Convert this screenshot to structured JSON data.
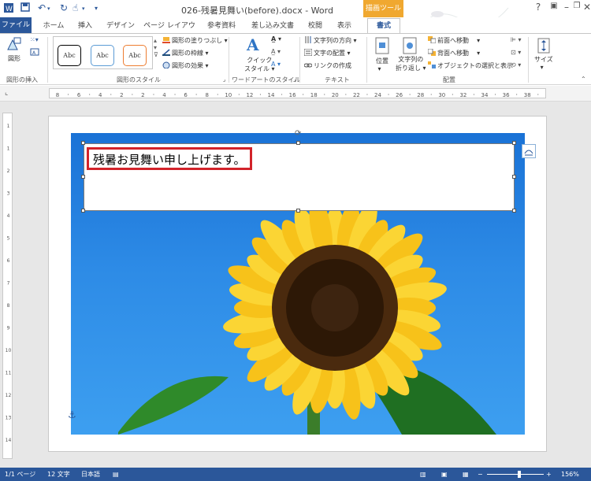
{
  "window": {
    "title": "026-残暑見舞い(before).docx - Word",
    "context_tab_group": "描画ツール"
  },
  "tabs": [
    {
      "label": "ファイル"
    },
    {
      "label": "ホーム"
    },
    {
      "label": "挿入"
    },
    {
      "label": "デザイン"
    },
    {
      "label": "ページ レイアウト"
    },
    {
      "label": "参考資料"
    },
    {
      "label": "差し込み文書"
    },
    {
      "label": "校閲"
    },
    {
      "label": "表示"
    },
    {
      "label": "書式"
    }
  ],
  "ribbon": {
    "insert_shapes": {
      "shape_button": "図形",
      "group_label": "図形の挿入"
    },
    "shape_styles": {
      "gallery": [
        "Abc",
        "Abc",
        "Abc"
      ],
      "fill": "図形の塗りつぶし",
      "outline": "図形の枠線",
      "effects": "図形の効果",
      "group_label": "図形のスタイル"
    },
    "wordart": {
      "quick_styles": "クイック\nスタイル",
      "quick_styles_l1": "クイック",
      "quick_styles_l2": "スタイル",
      "group_label": "ワードアートのスタイル"
    },
    "text": {
      "direction": "文字列の方向",
      "align": "文字の配置",
      "link": "リンクの作成",
      "group_label": "テキスト"
    },
    "arrange": {
      "position": "位置",
      "wrap_l1": "文字列の",
      "wrap_l2": "折り返し",
      "bring_forward": "前面へ移動",
      "send_backward": "背面へ移動",
      "selection_pane": "オブジェクトの選択と表示",
      "group_label": "配置"
    },
    "size": {
      "label": "サイズ"
    }
  },
  "ruler": {
    "h_ticks": [
      "8",
      "6",
      "4",
      "2",
      "2",
      "4",
      "6",
      "8",
      "10",
      "12",
      "14",
      "16",
      "18",
      "20",
      "22",
      "24",
      "26",
      "28",
      "30",
      "32",
      "34",
      "36",
      "38"
    ],
    "v_ticks": [
      "1",
      "1",
      "2",
      "3",
      "4",
      "5",
      "6",
      "7",
      "8",
      "9",
      "10",
      "11",
      "12",
      "13",
      "14"
    ]
  },
  "document": {
    "textbox_text": "残暑お見舞い申し上げます。"
  },
  "status": {
    "page": "1/1 ページ",
    "words": "12 文字",
    "language": "日本語",
    "zoom": "156%"
  },
  "colors": {
    "accent": "#2b579a",
    "context_tab": "#f0a830",
    "highlight": "#d2232a"
  }
}
